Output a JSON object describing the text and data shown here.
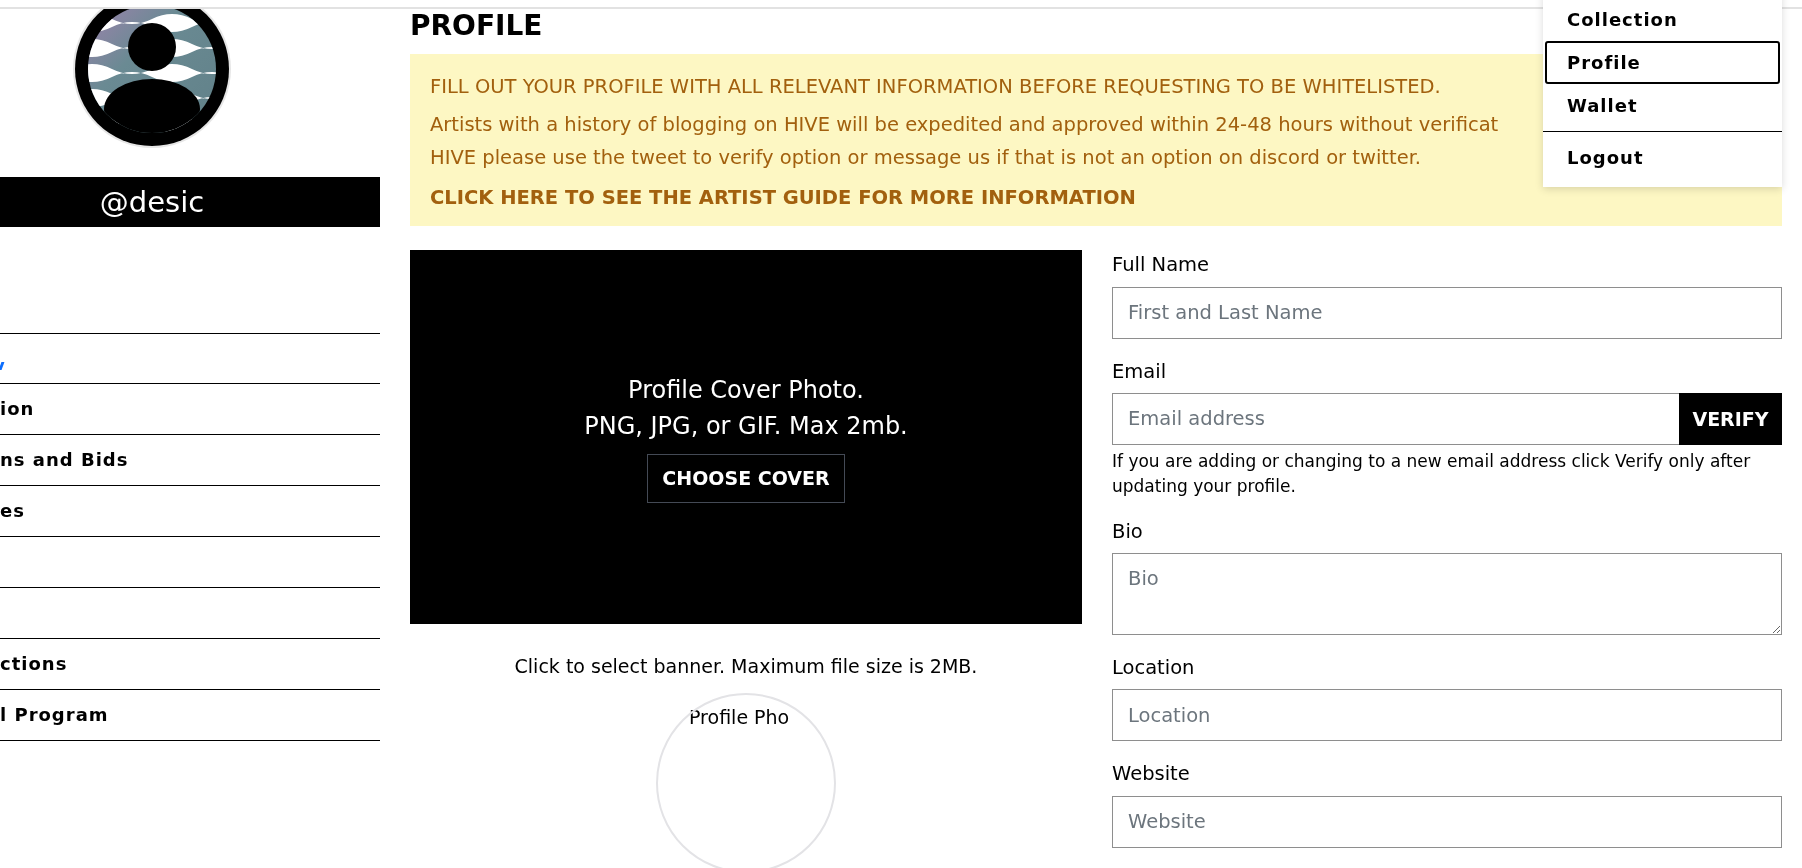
{
  "sidebar": {
    "username": "@desic",
    "items": [
      {
        "kind": "cut"
      },
      {
        "kind": "text",
        "label": "ion"
      },
      {
        "kind": "text",
        "label": "ns and Bids"
      },
      {
        "kind": "text",
        "label": "es"
      },
      {
        "kind": "blank"
      },
      {
        "kind": "blank"
      },
      {
        "kind": "text",
        "label": "ctions"
      },
      {
        "kind": "text",
        "label": "l Program"
      }
    ]
  },
  "page_title": "PROFILE",
  "alert": {
    "heading": "FILL OUT YOUR PROFILE WITH ALL RELEVANT INFORMATION BEFORE REQUESTING TO BE WHITELISTED.",
    "lines": [
      "Artists with a history of blogging on HIVE will be expedited and approved within 24-48 hours without verificat",
      "HIVE please use the tweet to verify option or message us if that is not an option on discord or twitter."
    ],
    "link": "CLICK HERE TO SEE THE ARTIST GUIDE FOR MORE INFORMATION"
  },
  "cover": {
    "lines": [
      "Profile Cover Photo.",
      "PNG, JPG, or GIF. Max 2mb."
    ],
    "button": "CHOOSE COVER",
    "hint": "Click to select banner. Maximum file size is 2MB."
  },
  "profile_photo": {
    "label": "Profile Pho"
  },
  "form": {
    "fields": [
      {
        "kind": "input",
        "label": "Full Name",
        "placeholder": "First and Last Name"
      },
      {
        "kind": "email",
        "label": "Email",
        "placeholder": "Email address",
        "button": "VERIFY",
        "help": "If you are adding or changing to a new email address click Verify only after updating your profile."
      },
      {
        "kind": "textarea",
        "label": "Bio",
        "placeholder": "Bio"
      },
      {
        "kind": "input",
        "label": "Location",
        "placeholder": "Location"
      },
      {
        "kind": "input",
        "label": "Website",
        "placeholder": "Website"
      }
    ]
  },
  "menu": {
    "items": [
      {
        "label": "Collection",
        "selected": false,
        "divider": false
      },
      {
        "label": "Profile",
        "selected": true,
        "divider": false
      },
      {
        "label": "Wallet",
        "selected": false,
        "divider": false
      },
      {
        "label": "Logout",
        "selected": false,
        "divider": true
      }
    ]
  }
}
